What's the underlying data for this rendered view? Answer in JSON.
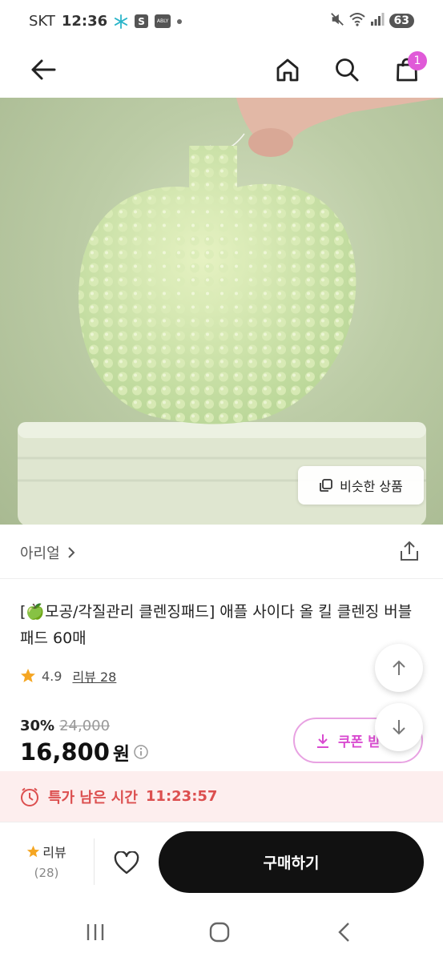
{
  "status_bar": {
    "carrier": "SKT",
    "time": "12:36",
    "notif_s": "S",
    "notif_ably": "ABLY",
    "battery": "63"
  },
  "header": {
    "cart_count": "1"
  },
  "image": {
    "similar_label": "비슷한 상품"
  },
  "brand": {
    "name": "아리얼"
  },
  "product": {
    "title_emoji": "🍏",
    "title": "모공/각질관리 클렌징패드] 애플 사이다 올 킬 클렌징 버블 패드 60매",
    "title_prefix": "[",
    "rating": "4.9",
    "review_label": "리뷰 28"
  },
  "price": {
    "discount_rate": "30%",
    "original": "24,000",
    "current": "16,800",
    "unit": "원",
    "coupon_label": "쿠폰 받"
  },
  "timer": {
    "label": "특가 남은 시간",
    "value": "11:23:57"
  },
  "bottom_bar": {
    "review_label": "리뷰",
    "review_count": "(28)",
    "buy_label": "구매하기"
  },
  "colors": {
    "accent": "#d94bd0",
    "badge": "#e05ad8",
    "timer_text": "#dc4f4f",
    "timer_bg": "#fdeeee",
    "star": "#f5a623",
    "buy_bg": "#111111"
  }
}
